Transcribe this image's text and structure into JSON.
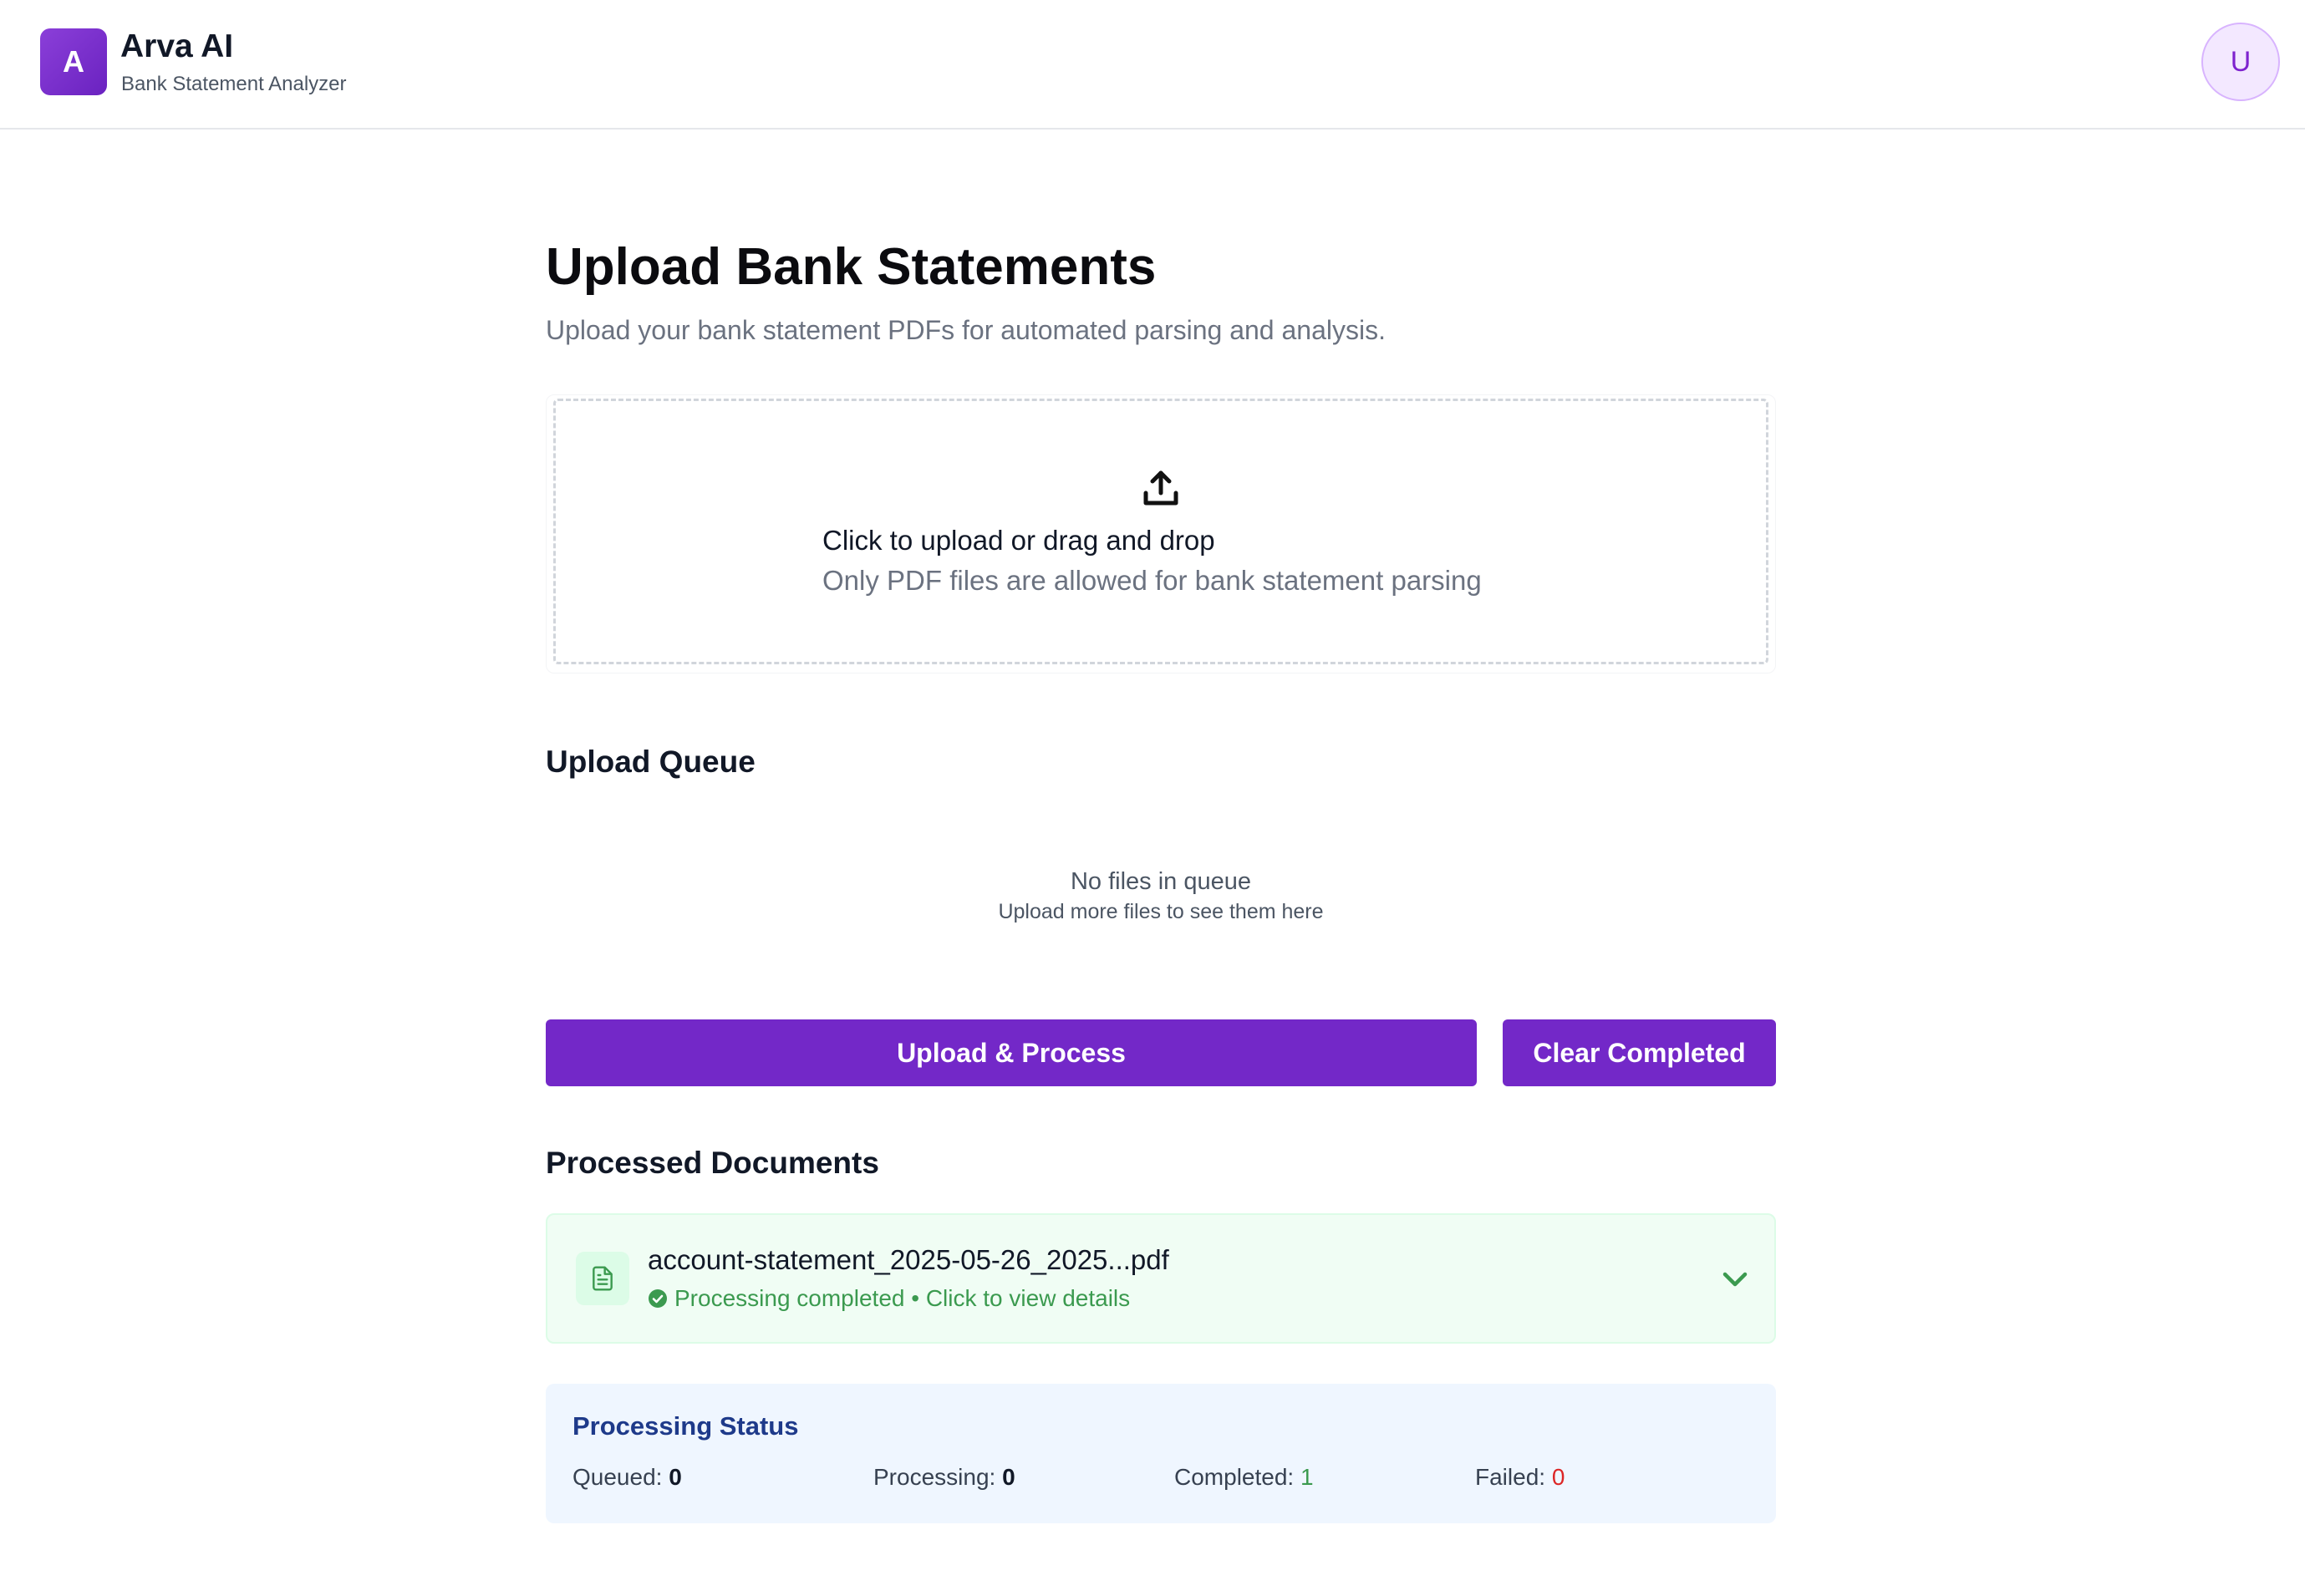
{
  "header": {
    "logo_letter": "A",
    "app_name": "Arva AI",
    "app_subtitle": "Bank Statement Analyzer",
    "avatar_initial": "U"
  },
  "main": {
    "title": "Upload Bank Statements",
    "description": "Upload your bank statement PDFs for automated parsing and analysis.",
    "dropzone": {
      "icon": "upload-icon",
      "title": "Click to upload or drag and drop",
      "hint": "Only PDF files are allowed for bank statement parsing"
    },
    "queue": {
      "heading": "Upload Queue",
      "empty_title": "No files in queue",
      "empty_subtitle": "Upload more files to see them here"
    },
    "actions": {
      "upload_label": "Upload & Process",
      "clear_label": "Clear Completed"
    },
    "processed": {
      "heading": "Processed Documents",
      "documents": [
        {
          "name": "account-statement_2025-05-26_2025...pdf",
          "status": "Processing completed • Click to view details",
          "icon": "file-text-icon"
        }
      ]
    },
    "status": {
      "heading": "Processing Status",
      "queued_label": "Queued:",
      "queued_value": "0",
      "processing_label": "Processing:",
      "processing_value": "0",
      "completed_label": "Completed:",
      "completed_value": "1",
      "failed_label": "Failed:",
      "failed_value": "0"
    }
  },
  "colors": {
    "brand": "#7328c8",
    "success": "#3b9a4f",
    "danger": "#dc2626",
    "status_heading": "#1e3a8a"
  }
}
